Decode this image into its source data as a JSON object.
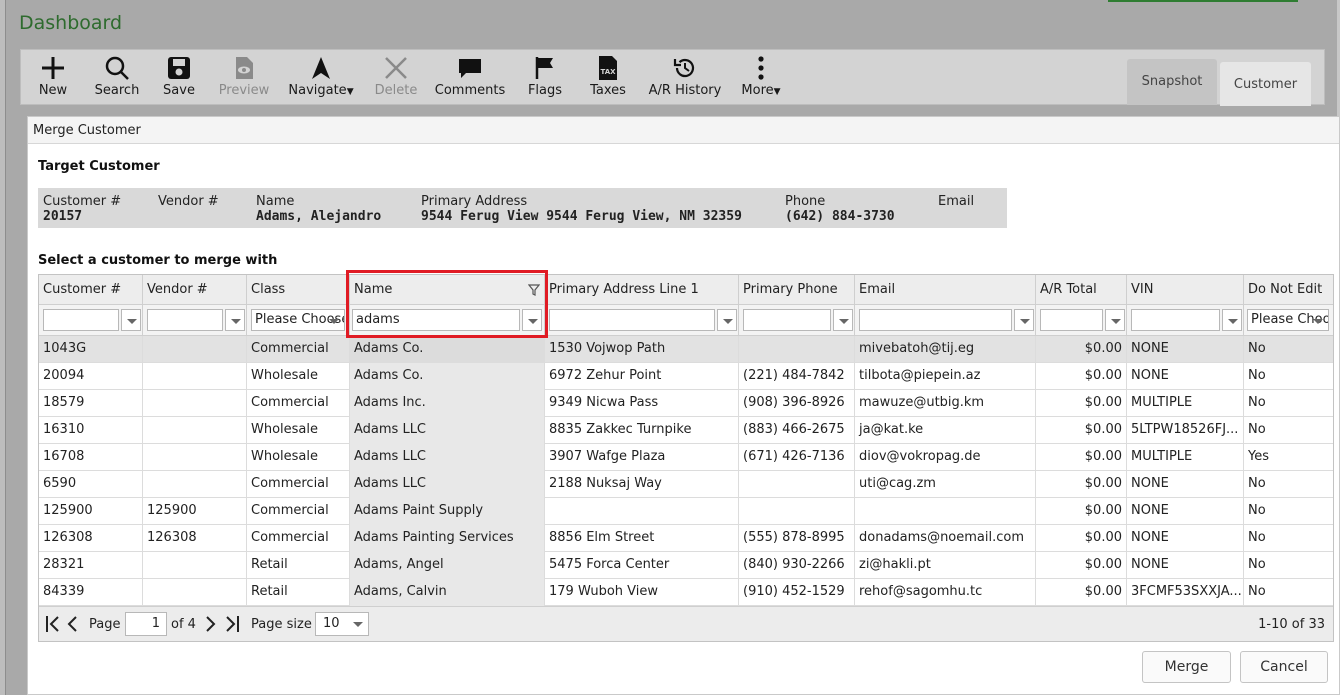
{
  "dashboard": {
    "title": "Dashboard"
  },
  "toolbar": {
    "new": "New",
    "search": "Search",
    "save": "Save",
    "preview": "Preview",
    "navigate": "Navigate",
    "delete": "Delete",
    "comments": "Comments",
    "flags": "Flags",
    "taxes": "Taxes",
    "ar_history": "A/R History",
    "more": "More",
    "taxes_icon_text": "TAX"
  },
  "tabs": {
    "snapshot": "Snapshot",
    "customer": "Customer"
  },
  "modal": {
    "title": "Merge Customer",
    "target_title": "Target Customer",
    "select_title": "Select a customer to merge with"
  },
  "target": {
    "customer_num_label": "Customer #",
    "customer_num": "20157",
    "vendor_num_label": "Vendor #",
    "vendor_num": "",
    "name_label": "Name",
    "name": "Adams, Alejandro",
    "address_label": "Primary Address",
    "address": "9544 Ferug View 9544 Ferug View, NM 32359",
    "phone_label": "Phone",
    "phone": "(642) 884-3730",
    "email_label": "Email",
    "email": ""
  },
  "grid": {
    "columns": [
      "Customer #",
      "Vendor #",
      "Class",
      "Name",
      "Primary Address Line 1",
      "Primary Phone",
      "Email",
      "A/R Total",
      "VIN",
      "Do Not Edit"
    ],
    "filters": {
      "class_placeholder": "Please Choose",
      "name_value": "adams",
      "do_not_edit_placeholder": "Please Choose"
    },
    "rows": [
      {
        "customer": "1043G",
        "vendor": "",
        "class": "Commercial",
        "name": "Adams Co.",
        "address": "1530 Vojwop Path",
        "phone": "",
        "email": "mivebatoh@tij.eg",
        "ar": "$0.00",
        "vin": "NONE",
        "dne": "No"
      },
      {
        "customer": "20094",
        "vendor": "",
        "class": "Wholesale",
        "name": "Adams Co.",
        "address": "6972 Zehur Point",
        "phone": "(221) 484-7842",
        "email": "tilbota@piepein.az",
        "ar": "$0.00",
        "vin": "NONE",
        "dne": "No"
      },
      {
        "customer": "18579",
        "vendor": "",
        "class": "Commercial",
        "name": "Adams Inc.",
        "address": "9349 Nicwa Pass",
        "phone": "(908) 396-8926",
        "email": "mawuze@utbig.km",
        "ar": "$0.00",
        "vin": "MULTIPLE",
        "dne": "No"
      },
      {
        "customer": "16310",
        "vendor": "",
        "class": "Wholesale",
        "name": "Adams LLC",
        "address": "8835 Zakkec Turnpike",
        "phone": "(883) 466-2675",
        "email": "ja@kat.ke",
        "ar": "$0.00",
        "vin": "5LTPW18526FJ...",
        "dne": "No"
      },
      {
        "customer": "16708",
        "vendor": "",
        "class": "Wholesale",
        "name": "Adams LLC",
        "address": "3907 Wafge Plaza",
        "phone": "(671) 426-7136",
        "email": "diov@vokropag.de",
        "ar": "$0.00",
        "vin": "MULTIPLE",
        "dne": "Yes"
      },
      {
        "customer": "6590",
        "vendor": "",
        "class": "Commercial",
        "name": "Adams LLC",
        "address": "2188 Nuksaj Way",
        "phone": "",
        "email": "uti@cag.zm",
        "ar": "$0.00",
        "vin": "NONE",
        "dne": "No"
      },
      {
        "customer": "125900",
        "vendor": "125900",
        "class": "Commercial",
        "name": "Adams Paint Supply",
        "address": "",
        "phone": "",
        "email": "",
        "ar": "$0.00",
        "vin": "NONE",
        "dne": "No"
      },
      {
        "customer": "126308",
        "vendor": "126308",
        "class": "Commercial",
        "name": "Adams Painting Services",
        "address": "8856 Elm Street",
        "phone": "(555) 878-8995",
        "email": "donadams@noemail.com",
        "ar": "$0.00",
        "vin": "NONE",
        "dne": "No"
      },
      {
        "customer": "28321",
        "vendor": "",
        "class": "Retail",
        "name": "Adams, Angel",
        "address": "5475 Forca Center",
        "phone": "(840) 930-2266",
        "email": "zi@hakli.pt",
        "ar": "$0.00",
        "vin": "NONE",
        "dne": "No"
      },
      {
        "customer": "84339",
        "vendor": "",
        "class": "Retail",
        "name": "Adams, Calvin",
        "address": "179 Wuboh View",
        "phone": "(910) 452-1529",
        "email": "rehof@sagomhu.tc",
        "ar": "$0.00",
        "vin": "3FCMF53SXXJA...",
        "dne": "No"
      }
    ]
  },
  "pager": {
    "page_label": "Page",
    "page": "1",
    "of_label": "of 4",
    "page_size_label": "Page size",
    "page_size": "10",
    "summary": "1-10 of 33"
  },
  "actions": {
    "merge": "Merge",
    "cancel": "Cancel"
  }
}
